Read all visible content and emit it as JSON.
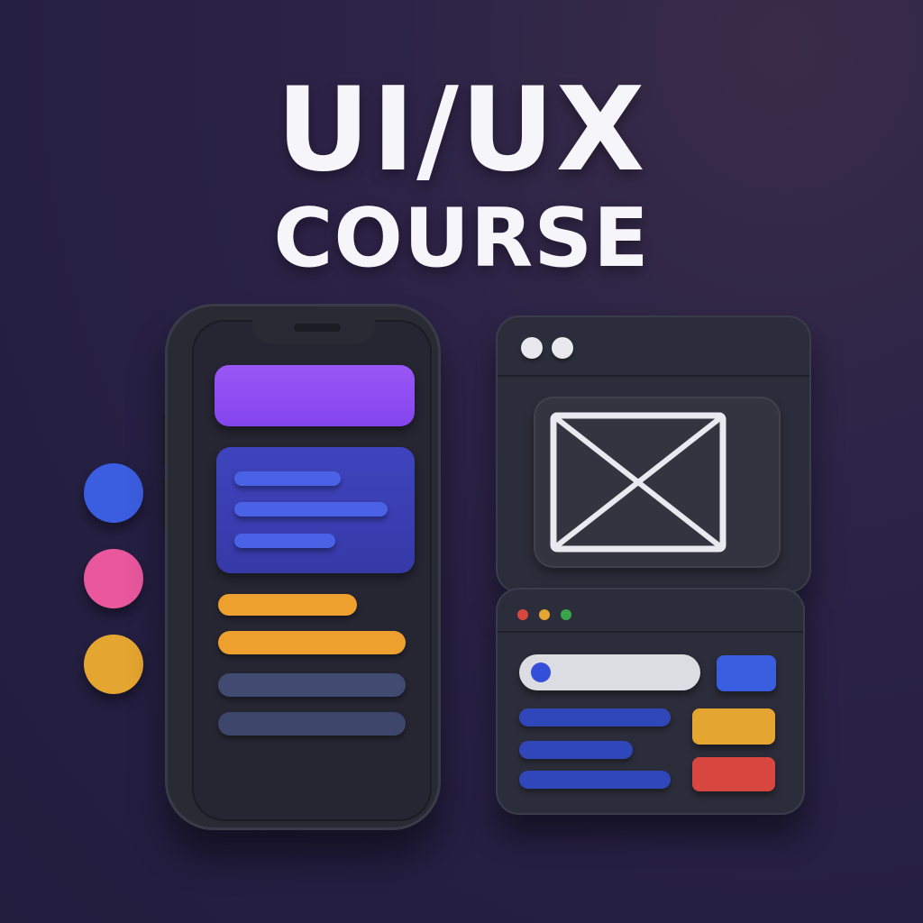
{
  "title": {
    "line1": "UI/UX",
    "line2": "COURSE"
  },
  "colors": {
    "purple": "#8d4cf2",
    "blue_card": "#3a3fb0",
    "blue": "#3f5fe0",
    "orange": "#eca12f",
    "slate": "#414a70",
    "pink": "#e9579d",
    "yellow": "#e5a531",
    "red": "#d8473f",
    "green": "#38a54d",
    "light": "#dcdde3"
  },
  "icons": {
    "image_placeholder": "image-placeholder-icon"
  }
}
